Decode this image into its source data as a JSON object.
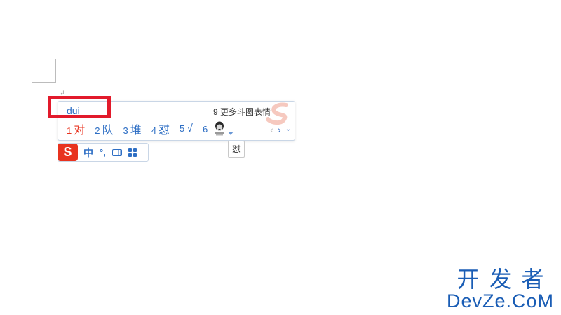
{
  "ime": {
    "composition": "dui",
    "more_emoji_label": "9 更多斗图表情",
    "candidates": [
      {
        "num": "1",
        "char": "对",
        "active": true
      },
      {
        "num": "2",
        "char": "队"
      },
      {
        "num": "3",
        "char": "堆"
      },
      {
        "num": "4",
        "char": "怼"
      },
      {
        "num": "5",
        "char": "√"
      }
    ],
    "sticker_num": "6",
    "nav": {
      "prev": "‹",
      "next": "›",
      "more": "⌄"
    },
    "tooltip": "怼"
  },
  "toolbar": {
    "logo": "S",
    "mode": "中",
    "punct": "°,"
  },
  "brand": {
    "cn": "开发者",
    "en": "DevZe.CoM"
  },
  "colors": {
    "accent": "#2d6ec4",
    "active": "#e8331f",
    "highlight": "#e21a2b",
    "brand": "#1a5db5"
  }
}
